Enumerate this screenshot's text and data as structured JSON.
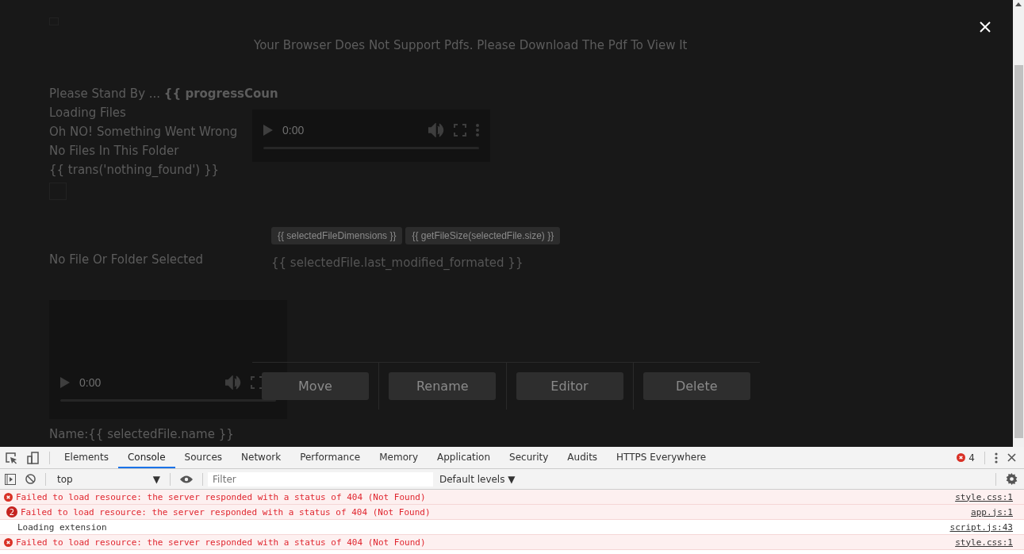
{
  "pdf_message": "Your Browser Does Not Support Pdfs. Please Download The Pdf To View It",
  "status_lines": [
    "Please Stand By ... **{{ progressCoun**",
    "Loading Files",
    "Oh NO! Something Went Wrong",
    "No Files In This Folder",
    "{{ trans('nothing_found') }}"
  ],
  "players": [
    {
      "kind": "compact",
      "time": "0:00"
    },
    {
      "kind": "tall",
      "time": "0:00"
    }
  ],
  "selection_message": "No File Or Folder Selected",
  "tags": [
    "{{ selectedFileDimensions }}",
    "{{ getFileSize(selectedFile.size) }}"
  ],
  "modified": "{{ selectedFile.last_modified_formated }}",
  "name_line": "Name:{{ selectedFile.name }}",
  "actions": [
    "Move",
    "Rename",
    "Editor",
    "Delete"
  ],
  "devtools": {
    "tabs": [
      {
        "label": "Elements",
        "selected": false
      },
      {
        "label": "Console",
        "selected": true
      },
      {
        "label": "Sources",
        "selected": false
      },
      {
        "label": "Network",
        "selected": false
      },
      {
        "label": "Performance",
        "selected": false
      },
      {
        "label": "Memory",
        "selected": false
      },
      {
        "label": "Application",
        "selected": false
      },
      {
        "label": "Security",
        "selected": false
      },
      {
        "label": "Audits",
        "selected": false
      },
      {
        "label": "HTTPS Everywhere",
        "selected": false
      }
    ],
    "error_count": "4",
    "context": "top",
    "context_arrow": "▼",
    "filter_placeholder": "Filter",
    "levels": "Default levels ▼",
    "messages": [
      {
        "kind": "error",
        "text": "Failed to load resource: the server responded with a status of 404 (Not Found)",
        "source": "style.css:1"
      },
      {
        "kind": "error",
        "count": "2",
        "text": "Failed to load resource: the server responded with a status of 404 (Not Found)",
        "source": "app.js:1"
      },
      {
        "kind": "info",
        "text": "Loading extension",
        "source": "script.js:43"
      },
      {
        "kind": "error",
        "text": "Failed to load resource: the server responded with a status of 404 (Not Found)",
        "source": "style.css:1"
      }
    ]
  }
}
